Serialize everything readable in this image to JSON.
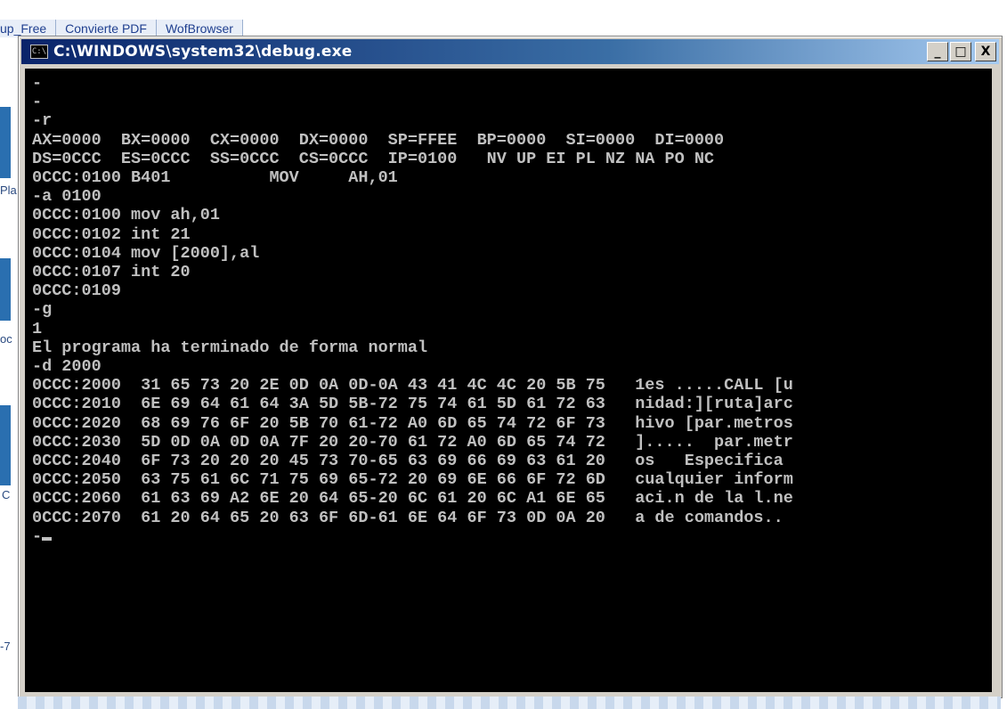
{
  "taskbar_tabs": [
    "up_Free",
    "Convierte PDF",
    "WofBrowser"
  ],
  "desktop_fragments": [
    "Pla",
    "oc",
    "C",
    "-7"
  ],
  "window": {
    "title": "C:\\WINDOWS\\system32\\debug.exe",
    "icon_text": "C:\\",
    "minimize": "_",
    "maximize": "□",
    "close": "X"
  },
  "console_lines": [
    "-",
    "-",
    "-r",
    "AX=0000  BX=0000  CX=0000  DX=0000  SP=FFEE  BP=0000  SI=0000  DI=0000",
    "DS=0CCC  ES=0CCC  SS=0CCC  CS=0CCC  IP=0100   NV UP EI PL NZ NA PO NC",
    "0CCC:0100 B401          MOV     AH,01",
    "-a 0100",
    "0CCC:0100 mov ah,01",
    "0CCC:0102 int 21",
    "0CCC:0104 mov [2000],al",
    "0CCC:0107 int 20",
    "0CCC:0109",
    "-g",
    "1",
    "El programa ha terminado de forma normal",
    "-d 2000",
    "0CCC:2000  31 65 73 20 2E 0D 0A 0D-0A 43 41 4C 4C 20 5B 75   1es .....CALL [u",
    "0CCC:2010  6E 69 64 61 64 3A 5D 5B-72 75 74 61 5D 61 72 63   nidad:][ruta]arc",
    "0CCC:2020  68 69 76 6F 20 5B 70 61-72 A0 6D 65 74 72 6F 73   hivo [par.metros",
    "0CCC:2030  5D 0D 0A 0D 0A 7F 20 20-70 61 72 A0 6D 65 74 72   ].....  par.metr",
    "0CCC:2040  6F 73 20 20 20 45 73 70-65 63 69 66 69 63 61 20   os   Especifica ",
    "0CCC:2050  63 75 61 6C 71 75 69 65-72 20 69 6E 66 6F 72 6D   cualquier inform",
    "0CCC:2060  61 63 69 A2 6E 20 64 65-20 6C 61 20 6C A1 6E 65   aci.n de la l.ne",
    "0CCC:2070  61 20 64 65 20 63 6F 6D-61 6E 64 6F 73 0D 0A 20   a de comandos.. "
  ],
  "prompt": "-",
  "colors": {
    "title_start": "#0a246a",
    "title_end": "#a6caf0",
    "console_bg": "#000000",
    "console_fg": "#c0c0c0",
    "window_face": "#d4d0c8"
  }
}
